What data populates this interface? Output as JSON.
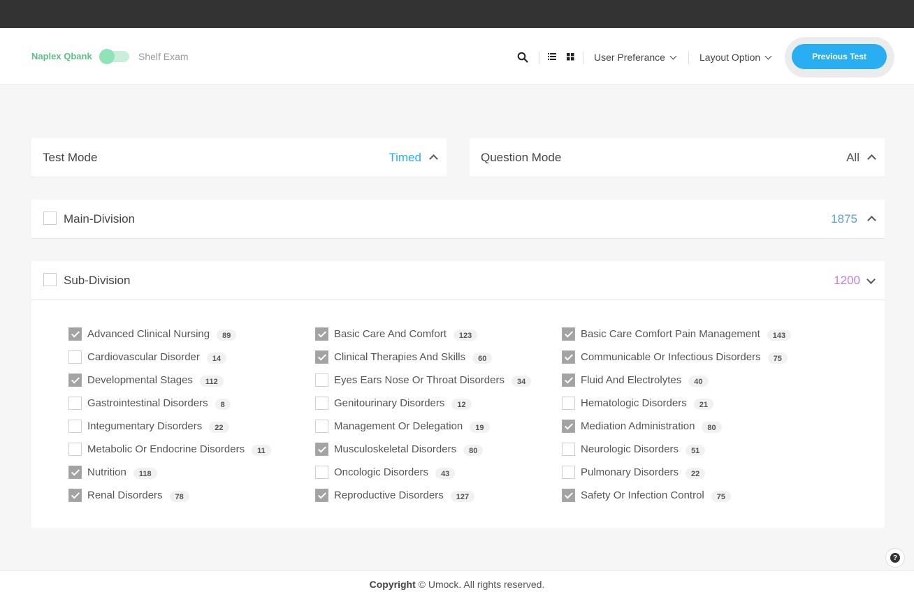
{
  "header": {
    "brand": "Naplex Qbank",
    "shelf_label": "Shelf Exam",
    "user_pref": "User Preferance",
    "layout_option": "Layout Option",
    "previous_test": "Previous Test"
  },
  "test_mode": {
    "title": "Test Mode",
    "value": "Timed",
    "value_color": "#2aaef2"
  },
  "question_mode": {
    "title": "Question Mode",
    "value": "All"
  },
  "main_division": {
    "title": "Main-Division",
    "count": "1875",
    "count_color": "#5a9fd8"
  },
  "sub_division": {
    "title": "Sub-Division",
    "count": "1200",
    "count_color": "#c07fd8",
    "items": [
      {
        "label": "Advanced Clinical Nursing",
        "count": "89",
        "checked": true
      },
      {
        "label": "Cardiovascular Disorder",
        "count": "14",
        "checked": false
      },
      {
        "label": "Developmental Stages",
        "count": "112",
        "checked": true
      },
      {
        "label": "Gastrointestinal Disorders",
        "count": "8",
        "checked": false
      },
      {
        "label": "Integumentary Disorders",
        "count": "22",
        "checked": false
      },
      {
        "label": "Metabolic Or Endocrine Disorders",
        "count": "11",
        "checked": false
      },
      {
        "label": "Nutrition",
        "count": "118",
        "checked": true
      },
      {
        "label": "Renal Disorders",
        "count": "78",
        "checked": true
      },
      {
        "label": "Basic Care And Comfort",
        "count": "123",
        "checked": true
      },
      {
        "label": "Clinical Therapies And Skills",
        "count": "60",
        "checked": true
      },
      {
        "label": "Eyes Ears Nose Or Throat Disorders",
        "count": "34",
        "checked": false
      },
      {
        "label": "Genitourinary Disorders",
        "count": "12",
        "checked": false
      },
      {
        "label": "Management Or Delegation",
        "count": "19",
        "checked": false
      },
      {
        "label": "Musculoskeletal Disorders",
        "count": "80",
        "checked": true
      },
      {
        "label": "Oncologic Disorders",
        "count": "43",
        "checked": false
      },
      {
        "label": "Reproductive Disorders",
        "count": "127",
        "checked": true
      },
      {
        "label": "Basic Care Comfort Pain Management",
        "count": "143",
        "checked": true
      },
      {
        "label": "Communicable Or Infectious Disorders",
        "count": "75",
        "checked": true
      },
      {
        "label": "Fluid And Electrolytes",
        "count": "40",
        "checked": true
      },
      {
        "label": "Hematologic Disorders",
        "count": "21",
        "checked": false
      },
      {
        "label": "Mediation Administration",
        "count": "80",
        "checked": true
      },
      {
        "label": "Neurologic Disorders",
        "count": "51",
        "checked": false
      },
      {
        "label": "Pulmonary Disorders",
        "count": "22",
        "checked": false
      },
      {
        "label": "Safety Or Infection Control",
        "count": "75",
        "checked": true
      }
    ]
  },
  "footer": {
    "copyright_label": "Copyright",
    "text": "© Umock. All rights reserved."
  },
  "help_icon": "?"
}
